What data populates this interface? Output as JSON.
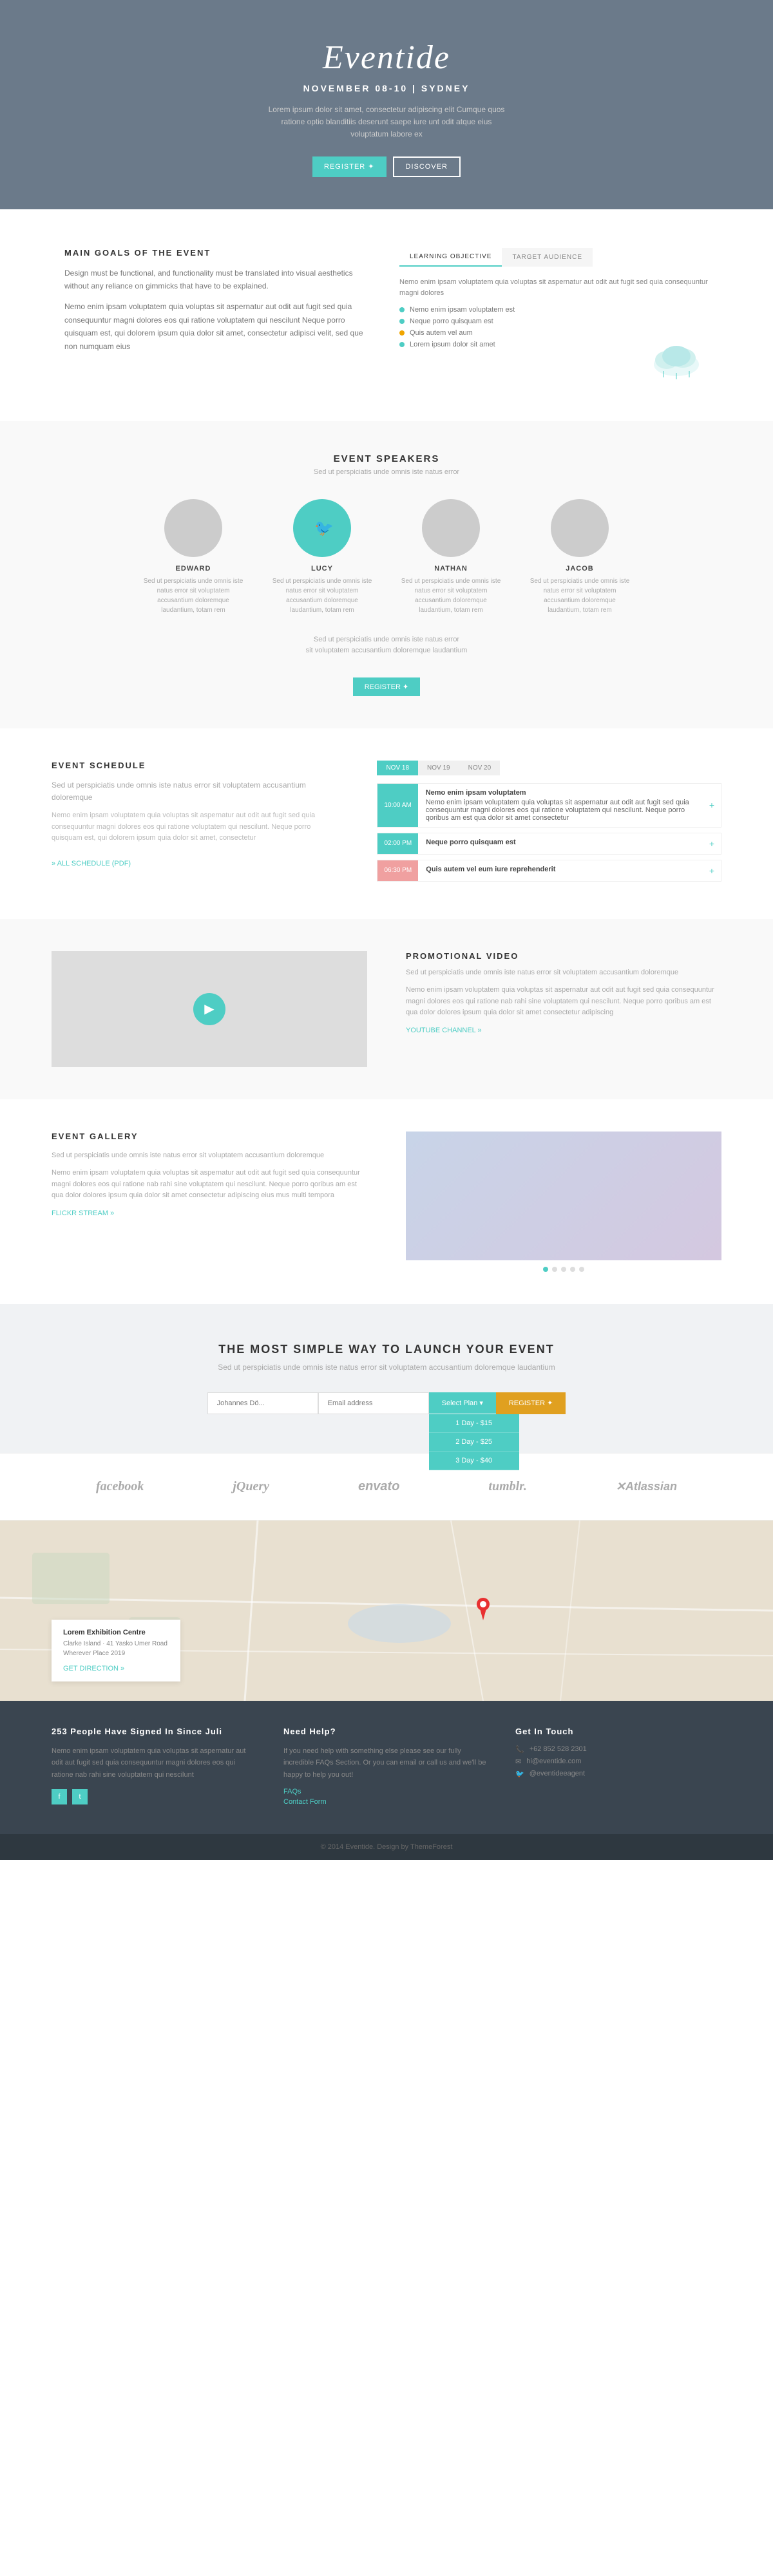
{
  "hero": {
    "logo": "Eventide",
    "date": "NOVEMBER 08-10 | SYDNEY",
    "description": "Lorem ipsum dolor sit amet, consectetur adipiscing elit Cumque quos ratione optio blanditiis deserunt saepe iure unt odit atque eius voluptatum labore ex",
    "register_label": "REGISTER ✦",
    "discover_label": "DISCOVER"
  },
  "goals": {
    "title": "MAIN GOALS OF THE EVENT",
    "description1": "Design must be functional, and functionality must be translated into visual aesthetics without any reliance on gimmicks that have to be explained.",
    "description2": "Nemo enim ipsam voluptatem quia voluptas sit aspernatur aut odit aut fugit sed quia consequuntur magni dolores eos qui ratione voluptatem qui nescilunt Neque porro quisquam est, qui dolorem ipsum quia dolor sit amet, consectetur adipisci velit, sed que non numquam eius",
    "tab1": "LEARNING OBJECTIVE",
    "tab2": "TARGET AUDIENCE",
    "tab_content": "Nemo enim ipsam voluptatem quia voluptas sit aspernatur aut odit aut fugit sed quia consequuntur magni dolores",
    "list_items": [
      "Nemo enim ipsam voluptatem est",
      "Neque porro quisquam est",
      "Quis autem vel aum",
      "Lorem ipsum dolor sit amet"
    ]
  },
  "speakers": {
    "title": "EVENT SPEAKERS",
    "subtitle": "Sed ut perspiciatis unde omnis iste natus error",
    "list": [
      {
        "name": "EDWARD",
        "desc": "Sed ut perspiciatis unde omnis iste natus error sit voluptatem accusantium doloremque laudantium, totam rem"
      },
      {
        "name": "LUCY",
        "desc": "Sed ut perspiciatis unde omnis iste natus error sit voluptatem accusantium doloremque laudantium, totam rem",
        "active": true
      },
      {
        "name": "NATHAN",
        "desc": "Sed ut perspiciatis unde omnis iste natus error sit voluptatem accusantium doloremque laudantium, totam rem"
      },
      {
        "name": "JACOB",
        "desc": "Sed ut perspiciatis unde omnis iste natus error sit voluptatem accusantium doloremque laudantium, totam rem"
      }
    ],
    "cta_text": "Sed ut perspiciatis unde omnis iste natus error\nsit voluptatem accusantium doloremque laudantium",
    "register_label": "REGISTER ✦"
  },
  "schedule": {
    "title": "EVENT SCHEDULE",
    "desc1": "Sed ut perspiciatis unde omnis iste natus error sit voluptatem accusantium doloremque",
    "desc2": "Nemo enim ipsam voluptatem quia voluptas sit aspernatur aut odit aut fugit sed quia consequuntur magni dolores eos qui ratione voluptatem qui nescilunt. Neque porro quisquam est, qui dolorem ipsum quia dolor sit amet, consectetur",
    "all_schedule": "» ALL SCHEDULE (PDF)",
    "tabs": [
      "NOV 18",
      "NOV 19",
      "NOV 20"
    ],
    "items": [
      {
        "time": "10:00 AM",
        "title": "Nemo enim ipsam voluptatem",
        "detail": "Nemo enim ipsam voluptatem quia voluptas sit aspernatur aut odit aut fugit sed quia consequuntur magni dolores eos qui ratione voluptatem",
        "color": "teal"
      },
      {
        "time": "02:00 PM",
        "title": "Neque porro quisquam est",
        "color": "teal"
      },
      {
        "time": "06:30 PM",
        "title": "Quis autem vel eum iure reprehenderit",
        "color": "pink"
      }
    ]
  },
  "promo": {
    "title": "PROMOTIONAL VIDEO",
    "desc1": "Sed ut perspiciatis unde omnis iste natus error sit voluptatem accusantium doloremque",
    "desc2": "Nemo enim ipsam voluptatem quia voluptas sit aspernatur aut odit aut fugit sed quia consequuntur magni dolores eos qui ratione nab rahi sine voluptatem qui nescilunt. Neque porro qoribus am est qua dolor dolores ipsum quia dolor sit amet consectetur adipiscing",
    "youtube": "YOUTUBE CHANNEL »"
  },
  "gallery": {
    "title": "EVENT GALLERY",
    "desc1": "Sed ut perspiciatis unde omnis iste natus error sit voluptatem accusantium doloremque",
    "desc2": "Nemo enim ipsam voluptatem quia voluptas sit aspernatur aut odit aut fugit sed quia consequuntur magni dolores eos qui ratione nab rahi sine voluptatem qui nescilunt. Neque porro qoribus am est qua dolor dolores ipsum quia dolor sit amet consectetur adipiscing eius mus multi tempora",
    "flickr": "FLICKR STREAM »"
  },
  "launch": {
    "title": "THE MOST SIMPLE WAY TO LAUNCH YOUR EVENT",
    "subtitle": "Sed ut perspiciatis unde omnis iste natus error\nsit voluptatem accusantium doloremque laudantium",
    "name_placeholder": "Johannes Dö...",
    "email_placeholder": "Email address",
    "select_plan_label": "Select Plan",
    "plan_options": [
      "1 Day - $15",
      "2 Day - $25",
      "3 Day - $40"
    ],
    "register_label": "REGISTER ✦"
  },
  "logos": {
    "items": [
      "facebook",
      "jQuery",
      "envato",
      "tumblr.",
      "XAtlassian"
    ]
  },
  "map": {
    "venue": "Lorem Exhibition Centre",
    "address": "Clarke Island · 41 Yasko Umer Road\nWherever Place 2019",
    "direction": "GET DIRECTION »"
  },
  "footer": {
    "counter": "253 People Have Signed In Since Juli",
    "col1_text": "Nemo enim ipsam voluptatem quia voluptas sit aspernatur aut odit aut fugit sed quia consequuntur magni dolores eos qui ratione nab rahi sine voluptatem qui nescilunt",
    "col2_title": "Need Help?",
    "col2_text": "If you need help with something else please see our fully incredible FAQs Section. Or you can email or call us and we'll be happy to help you out!",
    "col2_links": [
      "FAQs",
      "Contact Form"
    ],
    "col3_title": "Get In Touch",
    "col3_contact": [
      "+62 852 528 2301",
      "hi@eventide.com",
      "@eventideeagent"
    ],
    "bottom": "© 2014 Eventide. Design by ThemeForest"
  }
}
